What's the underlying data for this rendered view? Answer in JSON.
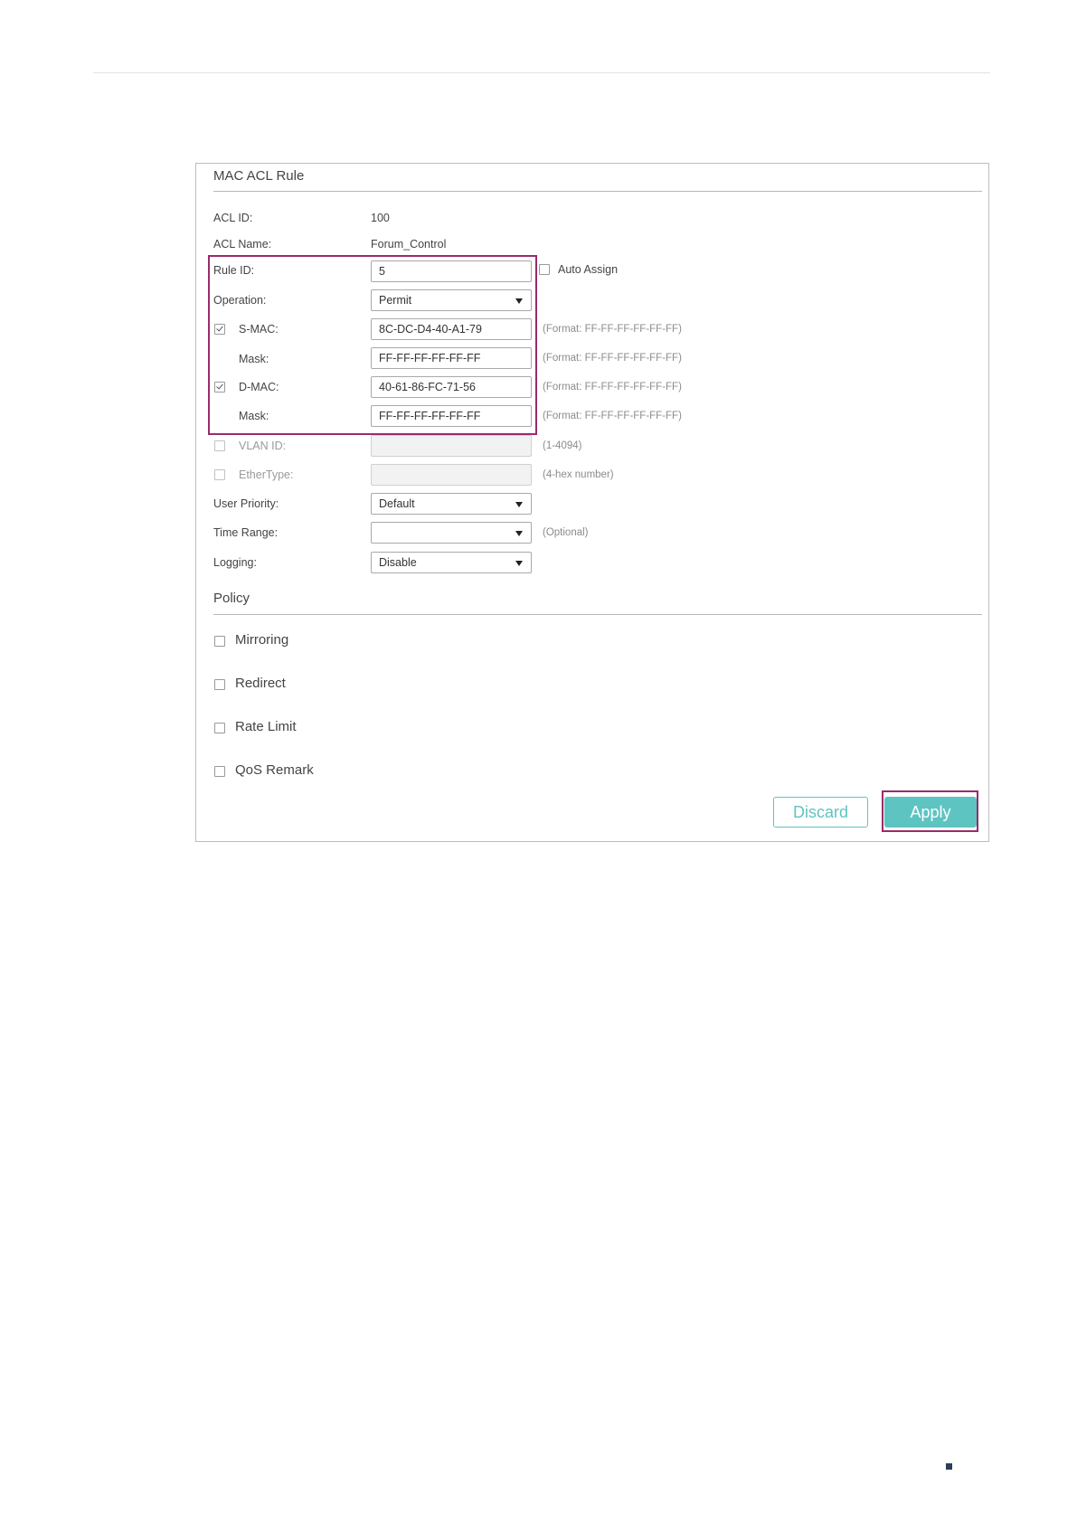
{
  "panel": {
    "title": "MAC ACL Rule",
    "acl_id_label": "ACL ID:",
    "acl_id_value": "100",
    "acl_name_label": "ACL Name:",
    "acl_name_value": "Forum_Control",
    "rule_id_label": "Rule ID:",
    "rule_id_value": "5",
    "auto_assign_label": "Auto Assign",
    "operation_label": "Operation:",
    "operation_value": "Permit",
    "smac_label": "S-MAC:",
    "smac_value": "8C-DC-D4-40-A1-79",
    "smac_checked": true,
    "smac_mask_label": "Mask:",
    "smac_mask_value": "FF-FF-FF-FF-FF-FF",
    "dmac_label": "D-MAC:",
    "dmac_value": "40-61-86-FC-71-56",
    "dmac_checked": true,
    "dmac_mask_label": "Mask:",
    "dmac_mask_value": "FF-FF-FF-FF-FF-FF",
    "format_hint": "(Format: FF-FF-FF-FF-FF-FF)",
    "vlan_id_label": "VLAN ID:",
    "vlan_id_hint": "(1-4094)",
    "ethertype_label": "EtherType:",
    "ethertype_hint": "(4-hex number)",
    "user_priority_label": "User Priority:",
    "user_priority_value": "Default",
    "time_range_label": "Time Range:",
    "time_range_value": "",
    "time_range_hint": "(Optional)",
    "logging_label": "Logging:",
    "logging_value": "Disable"
  },
  "policy": {
    "title": "Policy",
    "options": [
      "Mirroring",
      "Redirect",
      "Rate Limit",
      "QoS Remark"
    ]
  },
  "buttons": {
    "discard": "Discard",
    "apply": "Apply"
  },
  "colors": {
    "highlight": "#9a2b6b",
    "accent": "#5ec4c2",
    "corner_mark": "#2e3e55"
  }
}
